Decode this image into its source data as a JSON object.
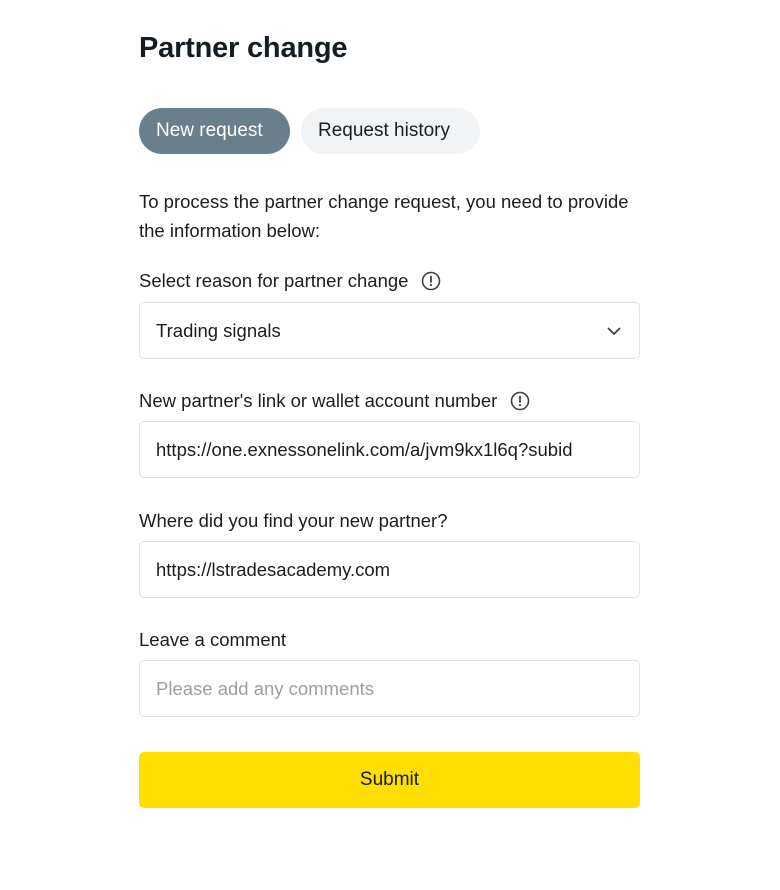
{
  "page": {
    "title": "Partner change"
  },
  "tabs": [
    {
      "label": "New request",
      "active": true
    },
    {
      "label": "Request history",
      "active": false
    }
  ],
  "intro": "To process the partner change request, you need to provide the information below:",
  "form": {
    "reason": {
      "label": "Select reason for partner change",
      "value": "Trading signals",
      "icon": "info-icon"
    },
    "partner_link": {
      "label": "New partner's link or wallet account number",
      "value": "https://one.exnessonelink.com/a/jvm9kx1l6q?subid",
      "icon": "info-icon"
    },
    "source": {
      "label": "Where did you find your new partner?",
      "value": "https://lstradesacademy.com"
    },
    "comment": {
      "label": "Leave a comment",
      "value": "",
      "placeholder": "Please add any comments"
    },
    "submit_label": "Submit"
  },
  "colors": {
    "active_tab": "#6a7f8d",
    "inactive_tab": "#f2f3f4",
    "submit": "#ffde02",
    "border": "#e1e3e5"
  }
}
